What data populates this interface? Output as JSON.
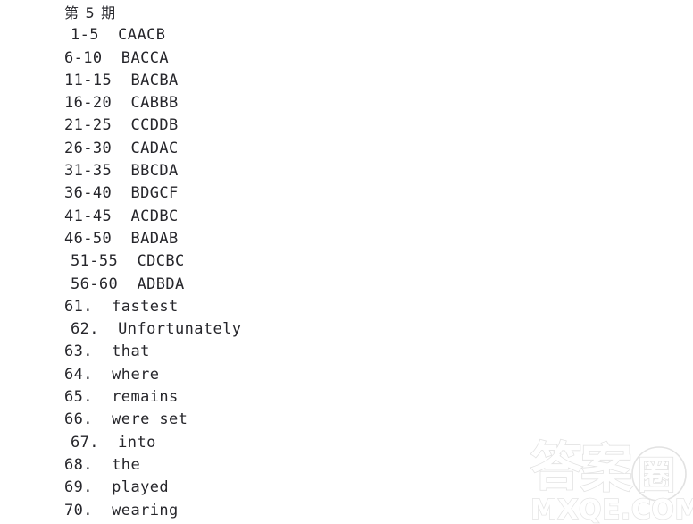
{
  "document": {
    "title": "第 5 期",
    "background_color": "#ffffff",
    "text_color": "#26262b",
    "lines": [
      {
        "text": "第 5 期",
        "indent": false,
        "heading": true
      },
      {
        "text": "1-5  CAACB",
        "indent": true,
        "heading": false
      },
      {
        "text": "6-10  BACCA",
        "indent": false,
        "heading": false
      },
      {
        "text": "11-15  BACBA",
        "indent": false,
        "heading": false
      },
      {
        "text": "16-20  CABBB",
        "indent": false,
        "heading": false
      },
      {
        "text": "21-25  CCDDB",
        "indent": false,
        "heading": false
      },
      {
        "text": "26-30  CADAC",
        "indent": false,
        "heading": false
      },
      {
        "text": "31-35  BBCDA",
        "indent": false,
        "heading": false
      },
      {
        "text": "36-40  BDGCF",
        "indent": false,
        "heading": false
      },
      {
        "text": "41-45  ACDBC",
        "indent": false,
        "heading": false
      },
      {
        "text": "46-50  BADAB",
        "indent": false,
        "heading": false
      },
      {
        "text": "51-55  CDCBC",
        "indent": true,
        "heading": false
      },
      {
        "text": "56-60  ADBDA",
        "indent": true,
        "heading": false
      },
      {
        "text": "61.  fastest",
        "indent": false,
        "heading": false
      },
      {
        "text": "62.  Unfortunately",
        "indent": true,
        "heading": false
      },
      {
        "text": "63.  that",
        "indent": false,
        "heading": false
      },
      {
        "text": "64.  where",
        "indent": false,
        "heading": false
      },
      {
        "text": "65.  remains",
        "indent": false,
        "heading": false
      },
      {
        "text": "66.  were set",
        "indent": false,
        "heading": false
      },
      {
        "text": "67.  into",
        "indent": true,
        "heading": false
      },
      {
        "text": "68.  the",
        "indent": false,
        "heading": false
      },
      {
        "text": "69.  played",
        "indent": false,
        "heading": false
      },
      {
        "text": "70.  wearing",
        "indent": false,
        "heading": false
      }
    ]
  },
  "watermark": {
    "cjk_char_1": "答",
    "cjk_char_2": "案",
    "cjk_char_3": "圈",
    "domain": "MXQE.COM",
    "color": "#e2e2e2"
  }
}
